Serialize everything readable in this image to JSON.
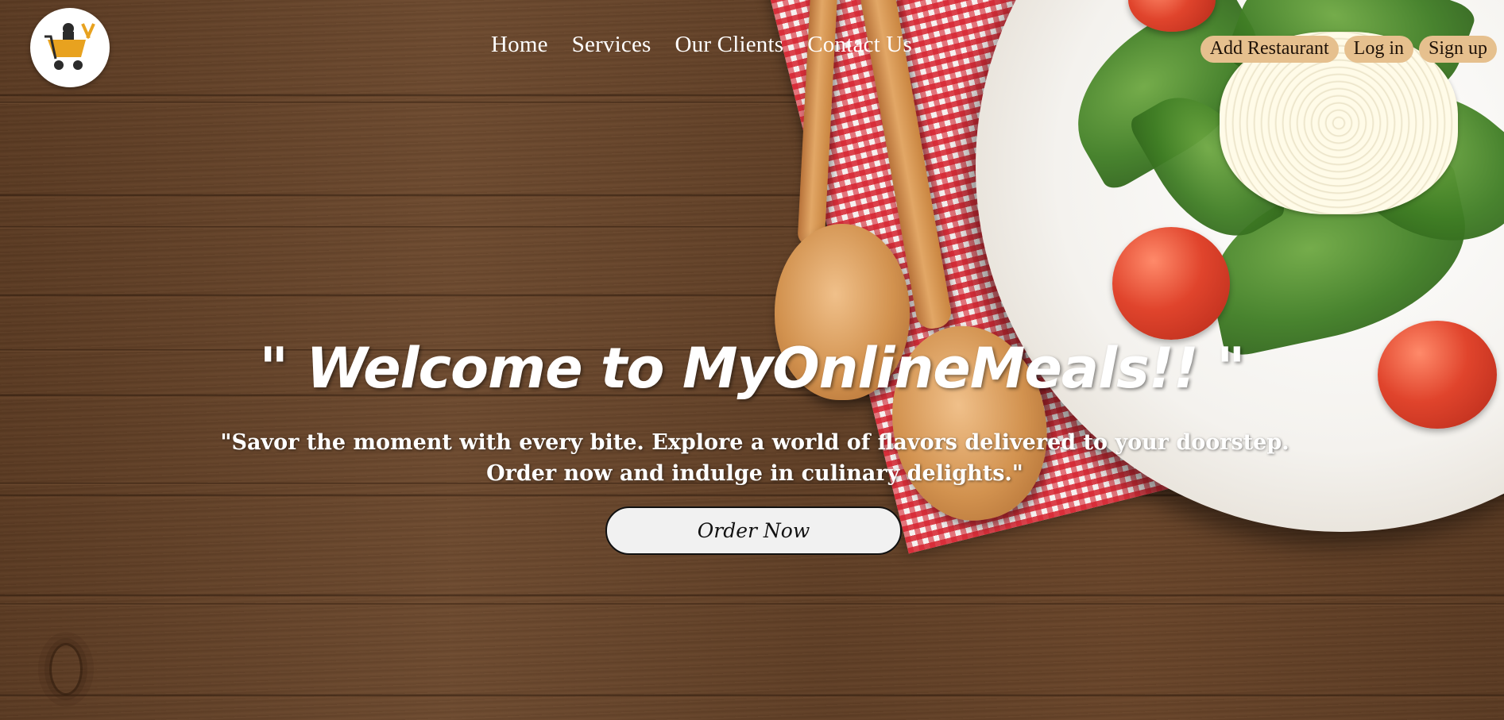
{
  "nav": {
    "links": [
      "Home",
      "Services",
      "Our Clients",
      "Contact Us"
    ]
  },
  "auth": {
    "add_restaurant": "Add Restaurant",
    "login": "Log in",
    "signup": "Sign up"
  },
  "hero": {
    "title": "\" Welcome to MyOnlineMeals!! \"",
    "subtitle": "\"Savor the moment with every bite. Explore a world of flavors delivered to your doorstep. Order now and indulge in culinary delights.\"",
    "cta": "Order Now"
  },
  "colors": {
    "auth_button_bg": "#e6c08e",
    "text_light": "#ffffff",
    "cta_bg": "#f1f1f1"
  },
  "icons": {
    "logo": "food-cart-chef-logo-icon"
  }
}
